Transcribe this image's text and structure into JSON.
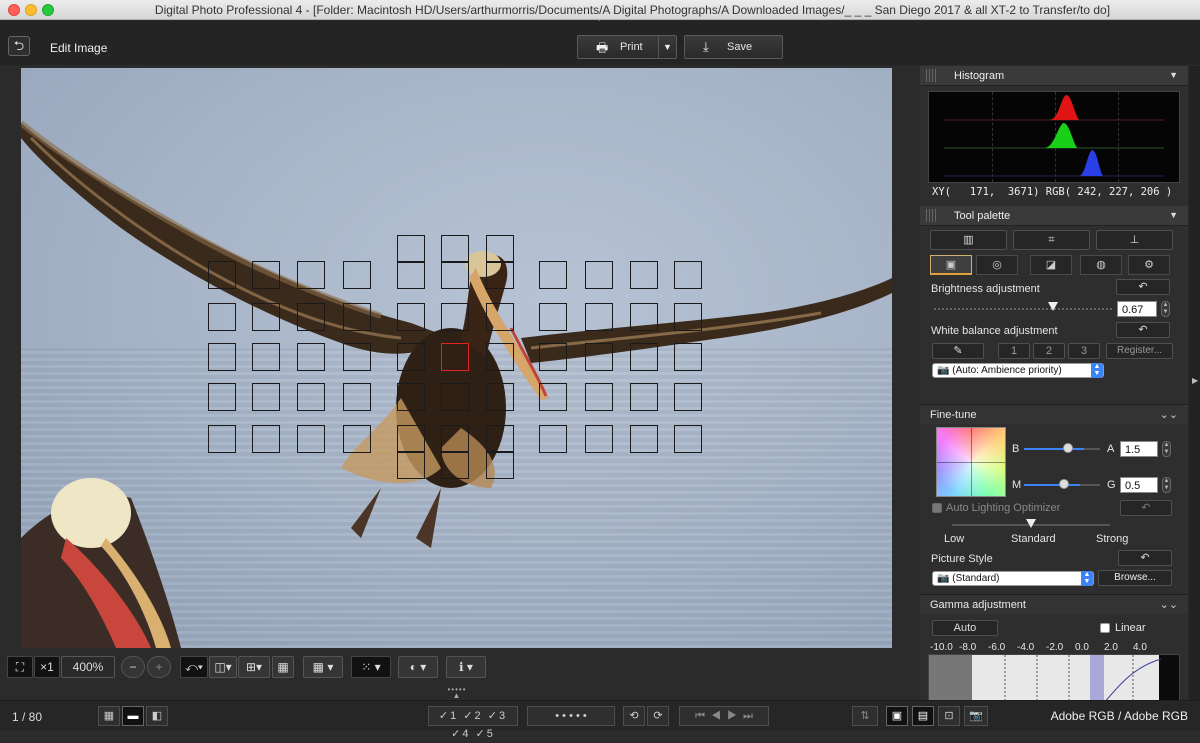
{
  "window": {
    "title": "Digital Photo Professional 4 - [Folder: Macintosh HD/Users/arthurmorris/Documents/A Digital Photographs/A Downloaded Images/_ _ _  San Diego 2017 & all XT-2 to Transfer/to do]"
  },
  "toolbar": {
    "edit_title": "Edit Image",
    "print_label": "Print",
    "save_label": "Save"
  },
  "bottom_tools": {
    "zoom_factor": "×1",
    "zoom_value": "400%",
    "zoom_out": "−",
    "zoom_in": "+"
  },
  "status": {
    "page": "1 / 80",
    "rating_1": "✓1",
    "rating_2": "✓2",
    "rating_3": "✓3",
    "rating_4": "✓4",
    "rating_5": "✓5",
    "stars": "•  •  •  •  •",
    "color_space": "Adobe RGB / Adobe RGB"
  },
  "histogram": {
    "title": "Histogram",
    "readout": "XY(   171,  3671) RGB( 242, 227, 206 )"
  },
  "tool_palette": {
    "title": "Tool palette",
    "brightness": {
      "label": "Brightness adjustment",
      "value": "0.67",
      "fraction": 0.66
    },
    "white_balance": {
      "label": "White balance adjustment",
      "slot1": "1",
      "slot2": "2",
      "slot3": "3",
      "register": "Register...",
      "preset": "(Auto: Ambience priority)"
    },
    "fine_tune": {
      "label": "Fine-tune",
      "b_label": "B",
      "a_label": "A",
      "a_value": "1.5",
      "m_label": "M",
      "g_label": "G",
      "g_value": "0.5"
    },
    "alo": {
      "label": "Auto Lighting Optimizer",
      "low": "Low",
      "standard": "Standard",
      "strong": "Strong"
    },
    "picture_style": {
      "label": "Picture Style",
      "value": "(Standard)",
      "browse": "Browse..."
    },
    "gamma": {
      "label": "Gamma adjustment",
      "auto": "Auto",
      "linear": "Linear",
      "ticks": [
        "-10.0",
        "-8.0",
        "-6.0",
        "-4.0",
        "-2.0",
        "0.0",
        "2.0",
        "4.0"
      ]
    }
  },
  "colors": {
    "accent": "#e0a13a",
    "af_active": "#e32222",
    "select_blue": "#3b83f7"
  }
}
